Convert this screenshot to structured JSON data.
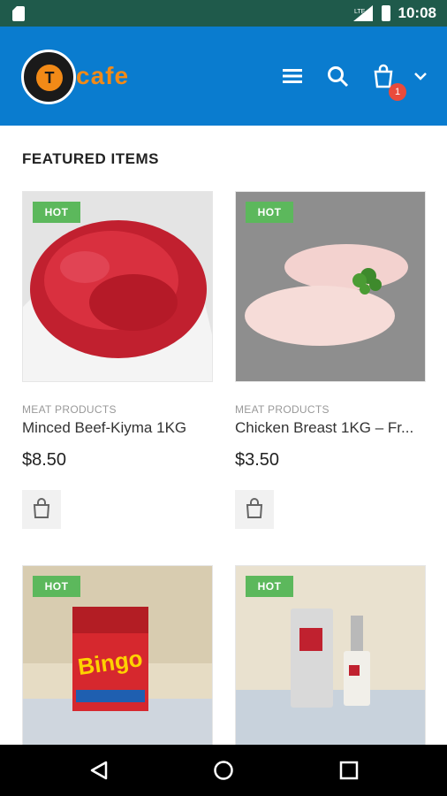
{
  "status_bar": {
    "time": "10:08"
  },
  "header": {
    "logo_letter": "T",
    "logo_word": "cafe",
    "cart_count": "1"
  },
  "section": {
    "title": "FEATURED ITEMS"
  },
  "products": [
    {
      "badge": "HOT",
      "category": "MEAT PRODUCTS",
      "name": "Minced Beef-Kiyma 1KG",
      "price": "$8.50"
    },
    {
      "badge": "HOT",
      "category": "MEAT PRODUCTS",
      "name": "Chicken Breast 1KG – Fr...",
      "price": "$3.50"
    },
    {
      "badge": "HOT"
    },
    {
      "badge": "HOT"
    }
  ],
  "colors": {
    "status_bar": "#1f5a4b",
    "header": "#0a7ccf",
    "accent": "#f28a17",
    "hot_badge": "#5cb85c",
    "cart_badge": "#e94b3c"
  }
}
